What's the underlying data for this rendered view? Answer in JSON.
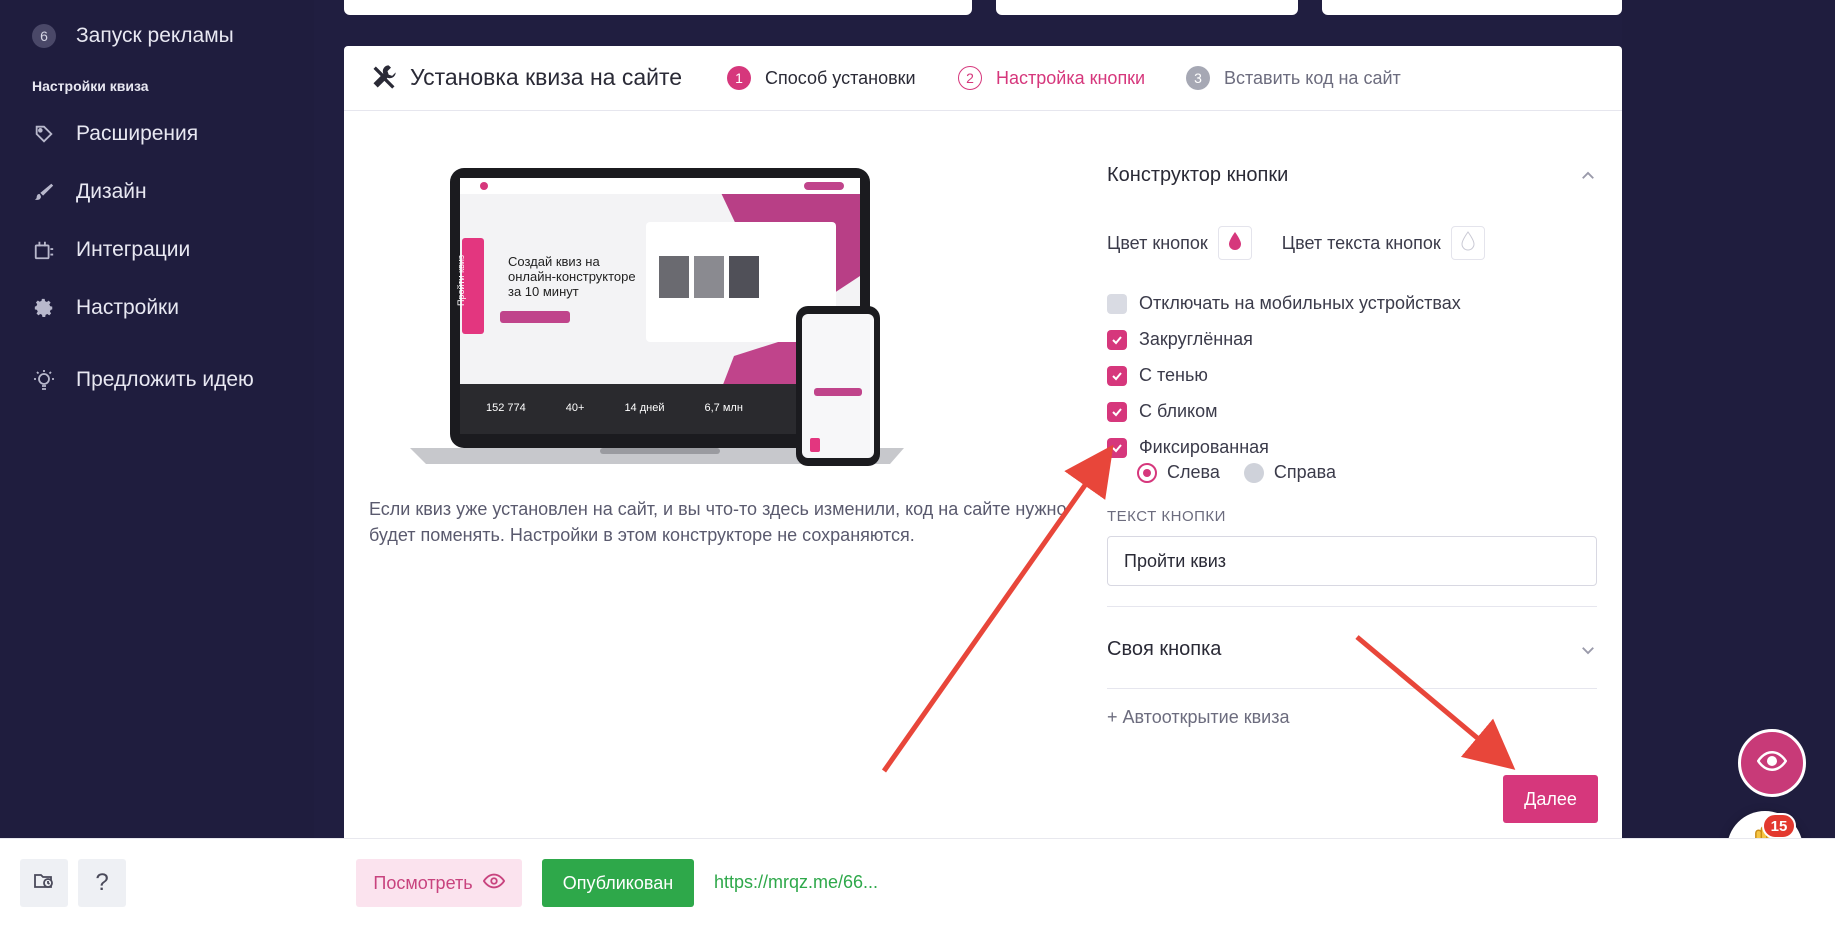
{
  "sidebar": {
    "launch": {
      "number": "6",
      "label": "Запуск рекламы"
    },
    "section_title": "Настройки квиза",
    "items": [
      {
        "label": "Расширения",
        "icon": "extensions-icon"
      },
      {
        "label": "Дизайн",
        "icon": "brush-icon"
      },
      {
        "label": "Интеграции",
        "icon": "integrations-icon"
      },
      {
        "label": "Настройки",
        "icon": "gear-icon"
      }
    ],
    "idea": {
      "label": "Предложить идею",
      "icon": "lightbulb-icon"
    }
  },
  "panel": {
    "title": "Установка квиза на сайте",
    "steps": [
      {
        "number": "1",
        "label": "Способ установки",
        "state": "done"
      },
      {
        "number": "2",
        "label": "Настройка кнопки",
        "state": "active"
      },
      {
        "number": "3",
        "label": "Вставить код на сайт",
        "state": "pending"
      }
    ],
    "description": "Если квиз уже установлен на сайт, и вы что-то здесь изменили, код на сайте нужно будет поменять. Настройки в этом конструкторе не сохраняются."
  },
  "illustration": {
    "laptop_text": {
      "heading_lines": [
        "Создай квиз на",
        "онлайн-конструкторе",
        "за 10 минут"
      ],
      "side_button": "Пройти квиз",
      "stats": [
        {
          "value": "152 774"
        },
        {
          "value": "40+"
        },
        {
          "value": "14 дней"
        },
        {
          "value": "6,7 млн"
        }
      ]
    }
  },
  "constructor": {
    "title": "Конструктор кнопки",
    "button_color_label": "Цвет кнопок",
    "text_color_label": "Цвет текста кнопок",
    "checkboxes": [
      {
        "label": "Отключать на мобильных устройствах",
        "checked": false
      },
      {
        "label": "Закруглённая",
        "checked": true
      },
      {
        "label": "С тенью",
        "checked": true
      },
      {
        "label": "С бликом",
        "checked": true
      },
      {
        "label": "Фиксированная",
        "checked": true
      }
    ],
    "position": [
      {
        "label": "Слева",
        "selected": true
      },
      {
        "label": "Справа",
        "selected": false
      }
    ],
    "text_field_label": "ТЕКСТ КНОПКИ",
    "text_field_value": "Пройти квиз",
    "custom_button_title": "Своя кнопка",
    "autoopen_label": "+ Автооткрытие квиза",
    "next_label": "Далее"
  },
  "floating": {
    "badge_count": "15"
  },
  "bottombar": {
    "help_label": "?",
    "preview_label": "Посмотреть",
    "published_label": "Опубликован",
    "link_text": "https://mrqz.me/66..."
  },
  "colors": {
    "accent": "#d6377c",
    "sidebar_bg": "#1f1d3e",
    "success": "#2ea84a",
    "arrow": "#e8463a"
  }
}
